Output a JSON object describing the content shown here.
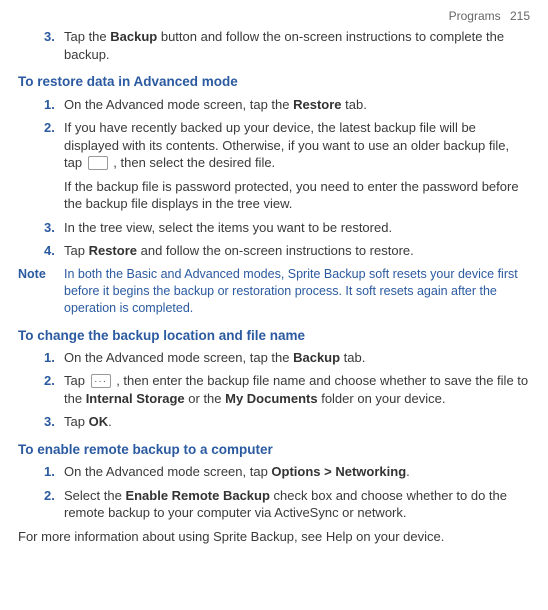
{
  "header": {
    "section": "Programs",
    "page": "215"
  },
  "step3": {
    "marker": "3.",
    "pre": "Tap the ",
    "bold": "Backup",
    "post": " button and follow the on-screen instructions to complete the backup."
  },
  "restore": {
    "heading": "To restore data in Advanced mode",
    "s1": {
      "marker": "1.",
      "pre": "On the Advanced mode screen, tap the ",
      "bold": "Restore",
      "post": " tab."
    },
    "s2": {
      "marker": "2.",
      "text_a": "If you have recently backed up your device, the latest backup file will be displayed with its contents. Otherwise, if you want to use an older backup file, tap ",
      "text_b": " , then select the desired file."
    },
    "s2b": "If the backup file is password protected, you need to enter the password before the backup file displays in the tree view.",
    "s3": {
      "marker": "3.",
      "text": "In the tree view, select the items you want to be restored."
    },
    "s4": {
      "marker": "4.",
      "pre": "Tap ",
      "bold": "Restore",
      "post": " and follow the on-screen instructions to restore."
    }
  },
  "note": {
    "label": "Note",
    "body": "In both the Basic and Advanced modes, Sprite Backup soft resets your device first before it begins the backup or restoration process. It soft resets again after the operation is completed."
  },
  "change": {
    "heading": "To change the backup location and file name",
    "s1": {
      "marker": "1.",
      "pre": "On the Advanced mode screen, tap the ",
      "bold": "Backup",
      "post": " tab."
    },
    "s2": {
      "marker": "2.",
      "pre": "Tap ",
      "mid": " , then enter the backup file name and choose whether to save the file to the ",
      "b1": "Internal Storage",
      "or": " or the ",
      "b2": "My Documents",
      "post": " folder on your device."
    },
    "s3": {
      "marker": "3.",
      "pre": "Tap ",
      "bold": "OK",
      "post": "."
    }
  },
  "remote": {
    "heading": "To enable remote backup to a computer",
    "s1": {
      "marker": "1.",
      "pre": "On the Advanced mode screen, tap ",
      "b1": "Options",
      "gt": " > ",
      "b2": "Networking",
      "post": "."
    },
    "s2": {
      "marker": "2.",
      "pre": "Select the ",
      "bold": "Enable Remote Backup",
      "post": " check box and choose whether to do the remote backup to your computer via ActiveSync or network."
    }
  },
  "closing": "For more information about using Sprite Backup, see Help on your device."
}
